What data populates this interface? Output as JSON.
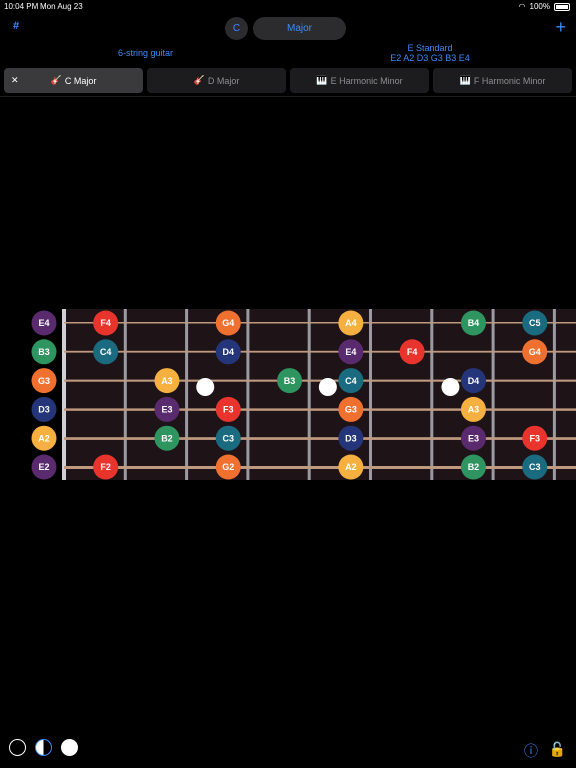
{
  "status_bar": {
    "time": "10:04 PM",
    "date": "Mon Aug 23",
    "battery": "100%"
  },
  "header": {
    "sharp_label": "#",
    "key_label": "C",
    "scale_label": "Major",
    "add_label": "+",
    "instrument_label": "6-string guitar",
    "tuning_name": "E Standard",
    "tuning_notes": "E2 A2 D3 G3 B3 E4"
  },
  "tabs": [
    {
      "label": "C Major",
      "icon": "guitar-icon",
      "active": true
    },
    {
      "label": "D Major",
      "icon": "guitar-icon",
      "active": false
    },
    {
      "label": "E Harmonic Minor",
      "icon": "piano-icon",
      "active": false
    },
    {
      "label": "F Harmonic Minor",
      "icon": "piano-icon",
      "active": false
    }
  ],
  "colors": {
    "accent": "#3a8bff",
    "C": "#1a6b80",
    "D": "#24357a",
    "E": "#5a2a6e",
    "F": "#e8342d",
    "G": "#f07030",
    "A": "#f5b040",
    "B": "#2e9560",
    "fretboard": "#1e1418",
    "string": "#c09a80",
    "fret": "#9a9aa0"
  },
  "fretboard": {
    "strings": [
      [
        {
          "f": 0,
          "n": "E4"
        },
        {
          "f": 1,
          "n": "F4"
        },
        {
          "f": 3,
          "n": "G4"
        },
        {
          "f": 5,
          "n": "A4"
        },
        {
          "f": 7,
          "n": "B4"
        },
        {
          "f": 8,
          "n": "C5"
        }
      ],
      [
        {
          "f": 0,
          "n": "B3"
        },
        {
          "f": 1,
          "n": "C4"
        },
        {
          "f": 3,
          "n": "D4"
        },
        {
          "f": 5,
          "n": "E4"
        },
        {
          "f": 6,
          "n": "F4"
        },
        {
          "f": 8,
          "n": "G4"
        }
      ],
      [
        {
          "f": 0,
          "n": "G3"
        },
        {
          "f": 2,
          "n": "A3"
        },
        {
          "f": 4,
          "n": "B3"
        },
        {
          "f": 5,
          "n": "C4"
        },
        {
          "f": 7,
          "n": "D4"
        }
      ],
      [
        {
          "f": 0,
          "n": "D3"
        },
        {
          "f": 2,
          "n": "E3"
        },
        {
          "f": 3,
          "n": "F3"
        },
        {
          "f": 5,
          "n": "G3"
        },
        {
          "f": 7,
          "n": "A3"
        }
      ],
      [
        {
          "f": 0,
          "n": "A2"
        },
        {
          "f": 2,
          "n": "B2"
        },
        {
          "f": 3,
          "n": "C3"
        },
        {
          "f": 5,
          "n": "D3"
        },
        {
          "f": 7,
          "n": "E3"
        },
        {
          "f": 8,
          "n": "F3"
        }
      ],
      [
        {
          "f": 0,
          "n": "E2"
        },
        {
          "f": 1,
          "n": "F2"
        },
        {
          "f": 3,
          "n": "G2"
        },
        {
          "f": 5,
          "n": "A2"
        },
        {
          "f": 7,
          "n": "B2"
        },
        {
          "f": 8,
          "n": "C3"
        }
      ]
    ],
    "inlay_frets": [
      3,
      5,
      7
    ]
  }
}
